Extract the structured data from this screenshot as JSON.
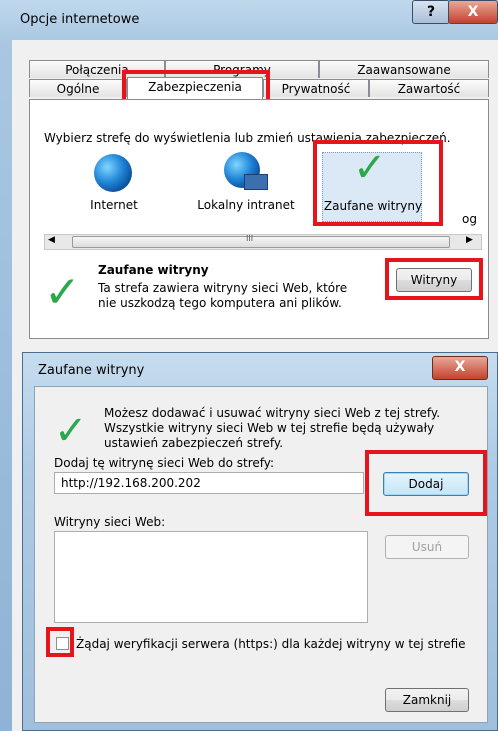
{
  "outer_window": {
    "title": "Opcje internetowe",
    "help_glyph": "?",
    "close_glyph": "X",
    "tabs_row1": [
      "Połączenia",
      "Programy",
      "Zaawansowane"
    ],
    "tabs_row2": [
      "Ogólne",
      "Zabezpieczenia",
      "Prywatność",
      "Zawartość"
    ],
    "zone_prompt": "Wybierz strefę do wyświetlenia lub zmień ustawienia zabezpieczeń.",
    "zones": [
      "Internet",
      "Lokalny intranet",
      "Zaufane witryny"
    ],
    "zone_overflow": "og",
    "scroll_glyphs": [
      "◀",
      "III",
      "▶"
    ],
    "selected_zone_title": "Zaufane witryny",
    "selected_zone_desc": "Ta strefa zawiera witryny sieci Web, które nie uszkodzą tego komputera ani plików.",
    "sites_button": "Witryny"
  },
  "dialog": {
    "title": "Zaufane witryny",
    "close_glyph": "X",
    "info_text": "Możesz dodawać i usuwać witryny sieci Web z tej strefy. Wszystkie witryny sieci Web w tej strefie będą używały ustawień zabezpieczeń strefy.",
    "add_label": "Dodaj tę witrynę sieci Web do strefy:",
    "add_value": "http://192.168.200.202",
    "add_button": "Dodaj",
    "sites_label": "Witryny sieci Web:",
    "sites": [],
    "remove_button": "Usuń",
    "https_checkbox_label": "Żądaj weryfikacji serwera (https:) dla każdej witryny w tej strefie",
    "https_checked": false,
    "close_button": "Zamknij"
  },
  "colors": {
    "highlight_red": "#e8141b",
    "check_green": "#2aa84a",
    "aero_blue": "#a9c7e2"
  }
}
